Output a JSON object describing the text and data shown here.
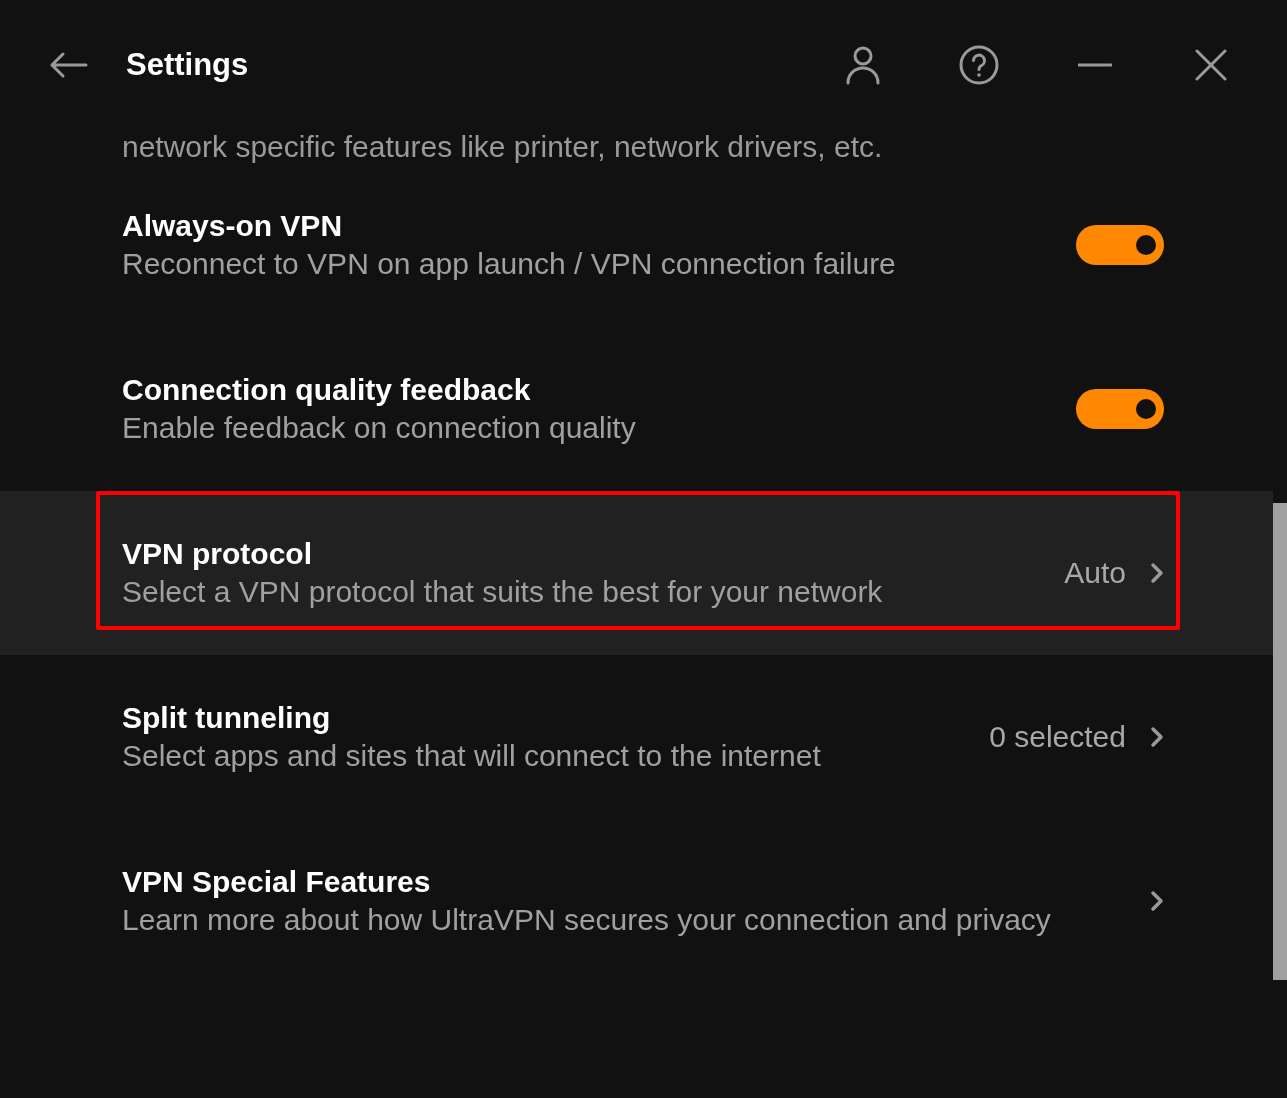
{
  "window": {
    "title": "Settings"
  },
  "intro_text": "network specific features like printer, network drivers, etc.",
  "settings": [
    {
      "kind": "toggle",
      "title": "Always-on VPN",
      "description": "Reconnect to VPN on app launch / VPN connection failure",
      "on": true,
      "highlighted": false
    },
    {
      "kind": "toggle",
      "title": "Connection quality feedback",
      "description": "Enable feedback on connection quality",
      "on": true,
      "highlighted": false
    },
    {
      "kind": "link",
      "title": "VPN protocol",
      "description": "Select a VPN protocol that suits the best for your network",
      "value": "Auto",
      "highlighted": true
    },
    {
      "kind": "link",
      "title": "Split tunneling",
      "description": "Select apps and sites that will connect to the internet",
      "value": "0 selected",
      "highlighted": false
    },
    {
      "kind": "link",
      "title": "VPN Special Features",
      "description": "Learn more about how UltraVPN secures your connection and privacy",
      "highlighted": false
    }
  ]
}
